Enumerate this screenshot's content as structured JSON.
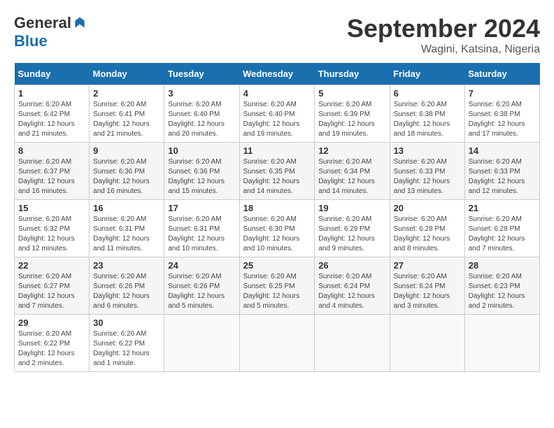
{
  "header": {
    "logo": {
      "general": "General",
      "blue": "Blue"
    },
    "title": "September 2024",
    "location": "Wagini, Katsina, Nigeria"
  },
  "weekdays": [
    "Sunday",
    "Monday",
    "Tuesday",
    "Wednesday",
    "Thursday",
    "Friday",
    "Saturday"
  ],
  "weeks": [
    [
      {
        "day": "1",
        "sunrise": "6:20 AM",
        "sunset": "6:42 PM",
        "daylight": "12 hours and 21 minutes."
      },
      {
        "day": "2",
        "sunrise": "6:20 AM",
        "sunset": "6:41 PM",
        "daylight": "12 hours and 21 minutes."
      },
      {
        "day": "3",
        "sunrise": "6:20 AM",
        "sunset": "6:40 PM",
        "daylight": "12 hours and 20 minutes."
      },
      {
        "day": "4",
        "sunrise": "6:20 AM",
        "sunset": "6:40 PM",
        "daylight": "12 hours and 19 minutes."
      },
      {
        "day": "5",
        "sunrise": "6:20 AM",
        "sunset": "6:39 PM",
        "daylight": "12 hours and 19 minutes."
      },
      {
        "day": "6",
        "sunrise": "6:20 AM",
        "sunset": "6:38 PM",
        "daylight": "12 hours and 18 minutes."
      },
      {
        "day": "7",
        "sunrise": "6:20 AM",
        "sunset": "6:38 PM",
        "daylight": "12 hours and 17 minutes."
      }
    ],
    [
      {
        "day": "8",
        "sunrise": "6:20 AM",
        "sunset": "6:37 PM",
        "daylight": "12 hours and 16 minutes."
      },
      {
        "day": "9",
        "sunrise": "6:20 AM",
        "sunset": "6:36 PM",
        "daylight": "12 hours and 16 minutes."
      },
      {
        "day": "10",
        "sunrise": "6:20 AM",
        "sunset": "6:36 PM",
        "daylight": "12 hours and 15 minutes."
      },
      {
        "day": "11",
        "sunrise": "6:20 AM",
        "sunset": "6:35 PM",
        "daylight": "12 hours and 14 minutes."
      },
      {
        "day": "12",
        "sunrise": "6:20 AM",
        "sunset": "6:34 PM",
        "daylight": "12 hours and 14 minutes."
      },
      {
        "day": "13",
        "sunrise": "6:20 AM",
        "sunset": "6:33 PM",
        "daylight": "12 hours and 13 minutes."
      },
      {
        "day": "14",
        "sunrise": "6:20 AM",
        "sunset": "6:33 PM",
        "daylight": "12 hours and 12 minutes."
      }
    ],
    [
      {
        "day": "15",
        "sunrise": "6:20 AM",
        "sunset": "6:32 PM",
        "daylight": "12 hours and 12 minutes."
      },
      {
        "day": "16",
        "sunrise": "6:20 AM",
        "sunset": "6:31 PM",
        "daylight": "12 hours and 11 minutes."
      },
      {
        "day": "17",
        "sunrise": "6:20 AM",
        "sunset": "6:31 PM",
        "daylight": "12 hours and 10 minutes."
      },
      {
        "day": "18",
        "sunrise": "6:20 AM",
        "sunset": "6:30 PM",
        "daylight": "12 hours and 10 minutes."
      },
      {
        "day": "19",
        "sunrise": "6:20 AM",
        "sunset": "6:29 PM",
        "daylight": "12 hours and 9 minutes."
      },
      {
        "day": "20",
        "sunrise": "6:20 AM",
        "sunset": "6:28 PM",
        "daylight": "12 hours and 8 minutes."
      },
      {
        "day": "21",
        "sunrise": "6:20 AM",
        "sunset": "6:28 PM",
        "daylight": "12 hours and 7 minutes."
      }
    ],
    [
      {
        "day": "22",
        "sunrise": "6:20 AM",
        "sunset": "6:27 PM",
        "daylight": "12 hours and 7 minutes."
      },
      {
        "day": "23",
        "sunrise": "6:20 AM",
        "sunset": "6:26 PM",
        "daylight": "12 hours and 6 minutes."
      },
      {
        "day": "24",
        "sunrise": "6:20 AM",
        "sunset": "6:26 PM",
        "daylight": "12 hours and 5 minutes."
      },
      {
        "day": "25",
        "sunrise": "6:20 AM",
        "sunset": "6:25 PM",
        "daylight": "12 hours and 5 minutes."
      },
      {
        "day": "26",
        "sunrise": "6:20 AM",
        "sunset": "6:24 PM",
        "daylight": "12 hours and 4 minutes."
      },
      {
        "day": "27",
        "sunrise": "6:20 AM",
        "sunset": "6:24 PM",
        "daylight": "12 hours and 3 minutes."
      },
      {
        "day": "28",
        "sunrise": "6:20 AM",
        "sunset": "6:23 PM",
        "daylight": "12 hours and 2 minutes."
      }
    ],
    [
      {
        "day": "29",
        "sunrise": "6:20 AM",
        "sunset": "6:22 PM",
        "daylight": "12 hours and 2 minutes."
      },
      {
        "day": "30",
        "sunrise": "6:20 AM",
        "sunset": "6:22 PM",
        "daylight": "12 hours and 1 minute."
      },
      null,
      null,
      null,
      null,
      null
    ]
  ],
  "labels": {
    "sunrise": "Sunrise:",
    "sunset": "Sunset:",
    "daylight": "Daylight:"
  }
}
